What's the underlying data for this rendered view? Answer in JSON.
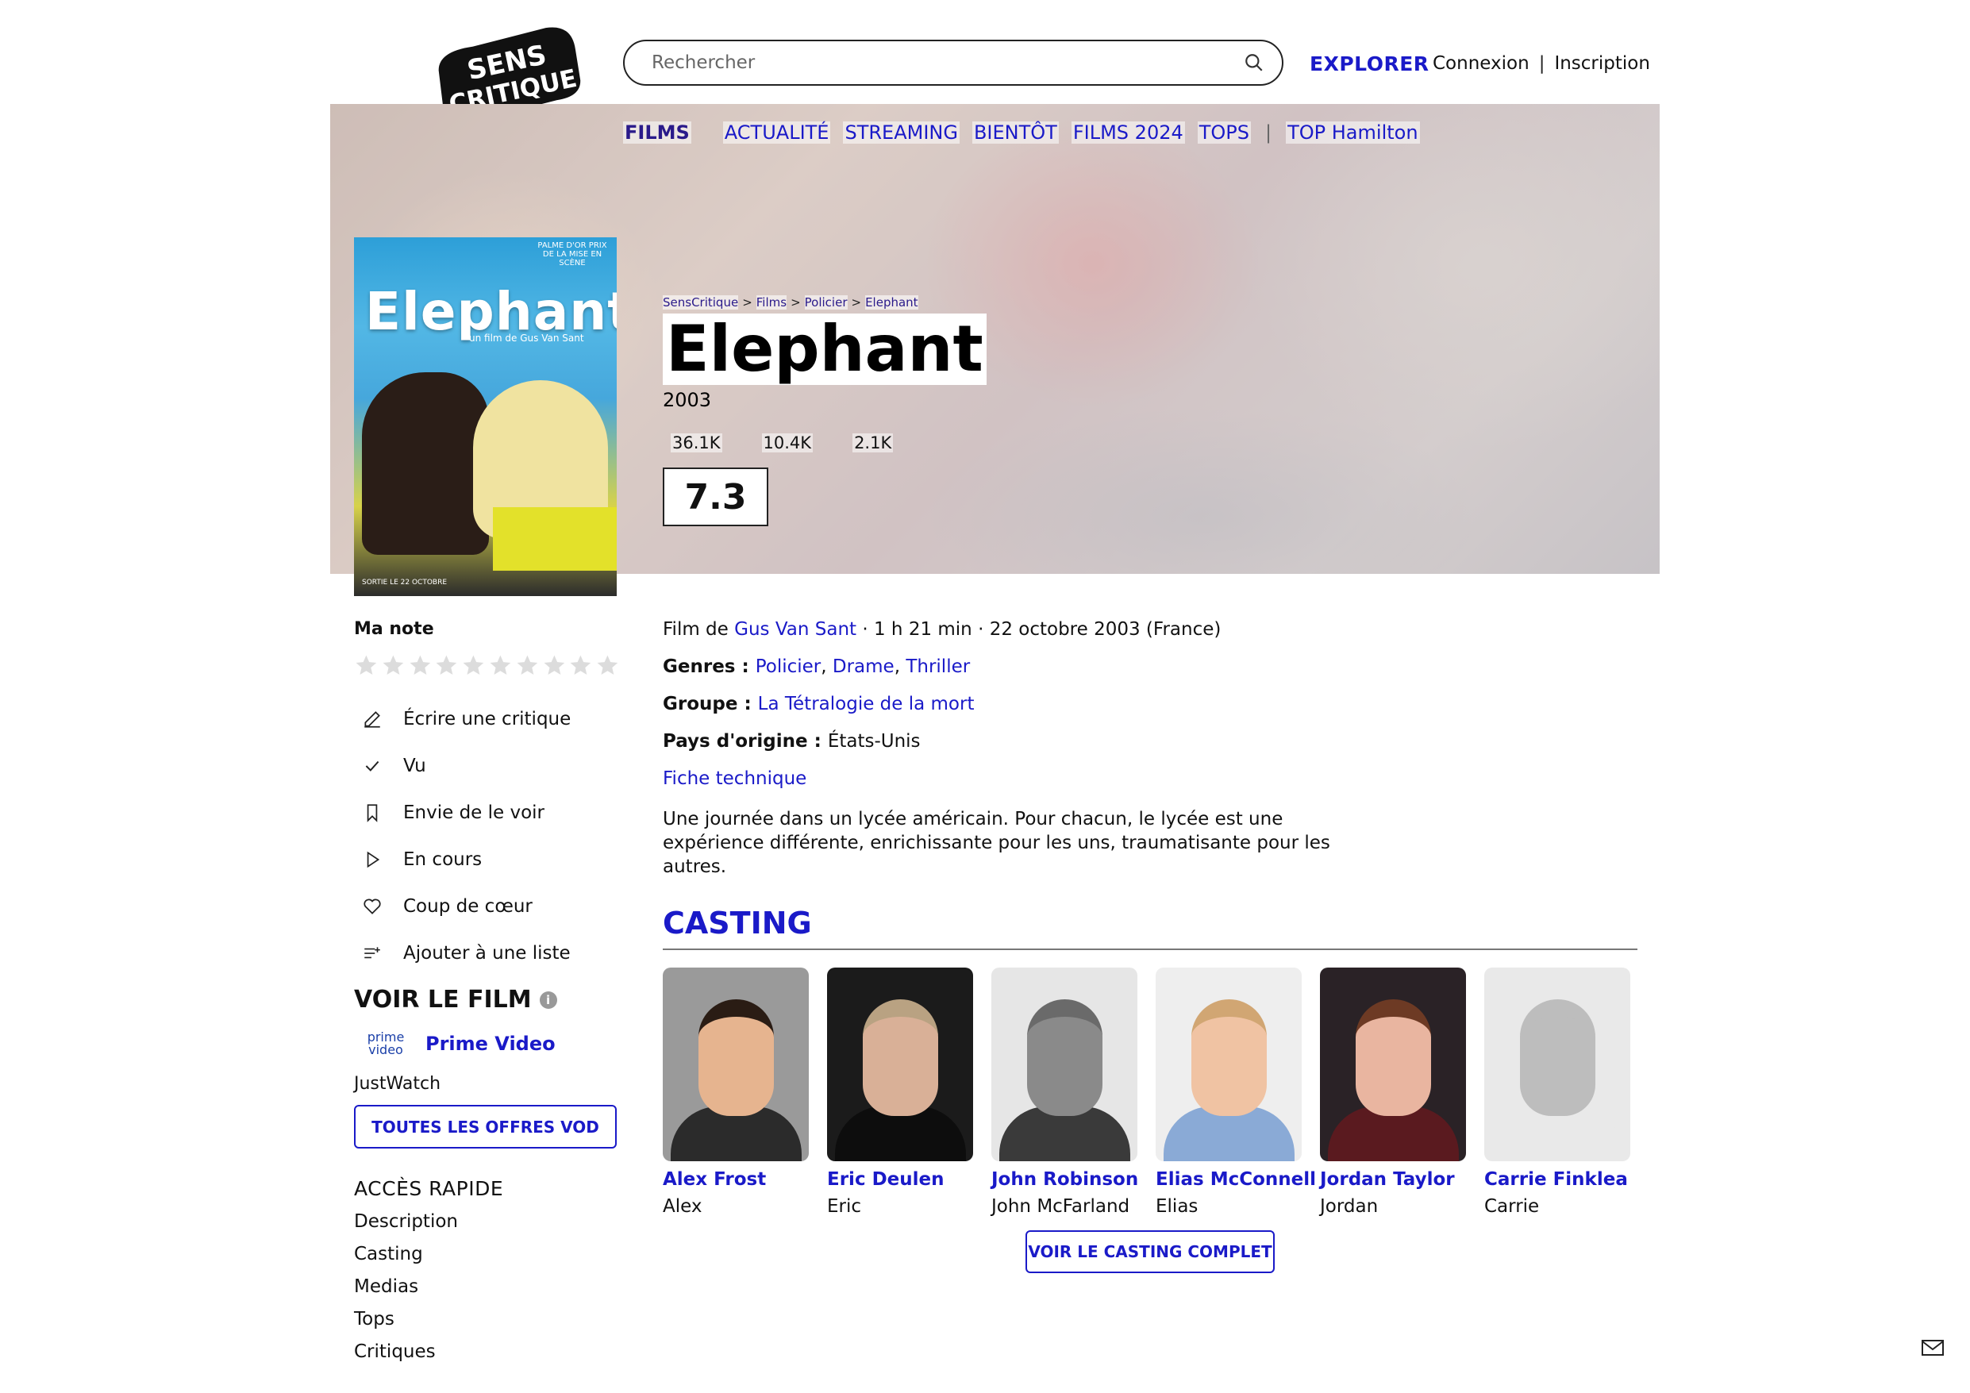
{
  "header": {
    "logo_text": "SENS CRITIQUE",
    "search_placeholder": "Rechercher",
    "explorer": "EXPLORER",
    "login": "Connexion",
    "separator": "|",
    "signup": "Inscription"
  },
  "nav": {
    "active": "FILMS",
    "items": [
      "ACTUALITÉ",
      "STREAMING",
      "BIENTÔT",
      "FILMS 2024",
      "TOPS"
    ],
    "divider": "|",
    "extra": "TOP Hamilton"
  },
  "breadcrumb": [
    "SensCritique",
    "Films",
    "Policier",
    "Elephant"
  ],
  "breadcrumb_sep": ">",
  "film": {
    "title": "Elephant",
    "year": "2003",
    "stats": [
      "36.1K",
      "10.4K",
      "2.1K"
    ],
    "score": "7.3",
    "poster_title": "Elephant",
    "poster_subtitle": "un film de Gus Van Sant",
    "poster_bottom": "SORTIE LE 22 OCTOBRE",
    "poster_palme": "PALME D'OR PRIX DE LA MISE EN SCÈNE"
  },
  "left": {
    "ma_note": "Ma note",
    "stars_count": 10,
    "actions": [
      {
        "icon": "pencil-icon",
        "label": "Écrire une critique"
      },
      {
        "icon": "check-icon",
        "label": "Vu"
      },
      {
        "icon": "bookmark-icon",
        "label": "Envie de le voir"
      },
      {
        "icon": "play-icon",
        "label": "En cours"
      },
      {
        "icon": "heart-icon",
        "label": "Coup de cœur"
      },
      {
        "icon": "list-add-icon",
        "label": "Ajouter à une liste"
      }
    ],
    "voir_le_film": "VOIR LE FILM",
    "info_glyph": "i",
    "prime_logo": "prime video",
    "prime_label": "Prime Video",
    "justwatch": "JustWatch",
    "vod_button": "TOUTES LES OFFRES VOD",
    "acces_rapide": "ACCÈS RAPIDE",
    "quick_links": [
      "Description",
      "Casting",
      "Medias",
      "Tops",
      "Critiques"
    ]
  },
  "details": {
    "film_de_prefix": "Film de ",
    "director": "Gus Van Sant",
    "meta": " · 1 h 21 min · 22 octobre 2003 (France)",
    "genres_label": "Genres : ",
    "genres": [
      "Policier",
      "Drame",
      "Thriller"
    ],
    "groupe_label": "Groupe : ",
    "groupe": "La Tétralogie de la mort",
    "pays_label": "Pays d'origine : ",
    "pays": "États-Unis",
    "fiche": "Fiche technique",
    "synopsis": "Une journée dans un lycée américain. Pour chacun, le lycée est une expérience différente, enrichissante pour les uns, traumatisante pour les autres."
  },
  "casting": {
    "heading": "CASTING",
    "actors": [
      {
        "name": "Alex Frost",
        "role": "Alex",
        "bg": "#9a9a9a",
        "skin": "#e6b48f",
        "hair": "#2a1c14",
        "cloth": "#2b2b2b"
      },
      {
        "name": "Eric Deulen",
        "role": "Eric",
        "bg": "#1b1b1b",
        "skin": "#d9b097",
        "hair": "#b9a282",
        "cloth": "#0d0d0d"
      },
      {
        "name": "John Robinson",
        "role": "John McFarland",
        "bg": "#e6e6e6",
        "skin": "#8a8a8a",
        "hair": "#6a6a6a",
        "cloth": "#3a3a3a"
      },
      {
        "name": "Elias McConnell",
        "role": "Elias",
        "bg": "#eeeeee",
        "skin": "#f0c3a3",
        "hair": "#d1a673",
        "cloth": "#8aaad6"
      },
      {
        "name": "Jordan Taylor",
        "role": "Jordan",
        "bg": "#2a2226",
        "skin": "#e9b5a0",
        "hair": "#6d3a24",
        "cloth": "#5a1a1f"
      },
      {
        "name": "Carrie Finklea",
        "role": "Carrie",
        "bg": "#e9e9e9",
        "skin": "#bdbdbd",
        "hair": "#bdbdbd",
        "cloth": "#e9e9e9"
      }
    ],
    "full_button": "VOIR LE CASTING COMPLET"
  },
  "colors": {
    "accent": "#1a1ac8",
    "active_nav": "#2a1a8a"
  }
}
